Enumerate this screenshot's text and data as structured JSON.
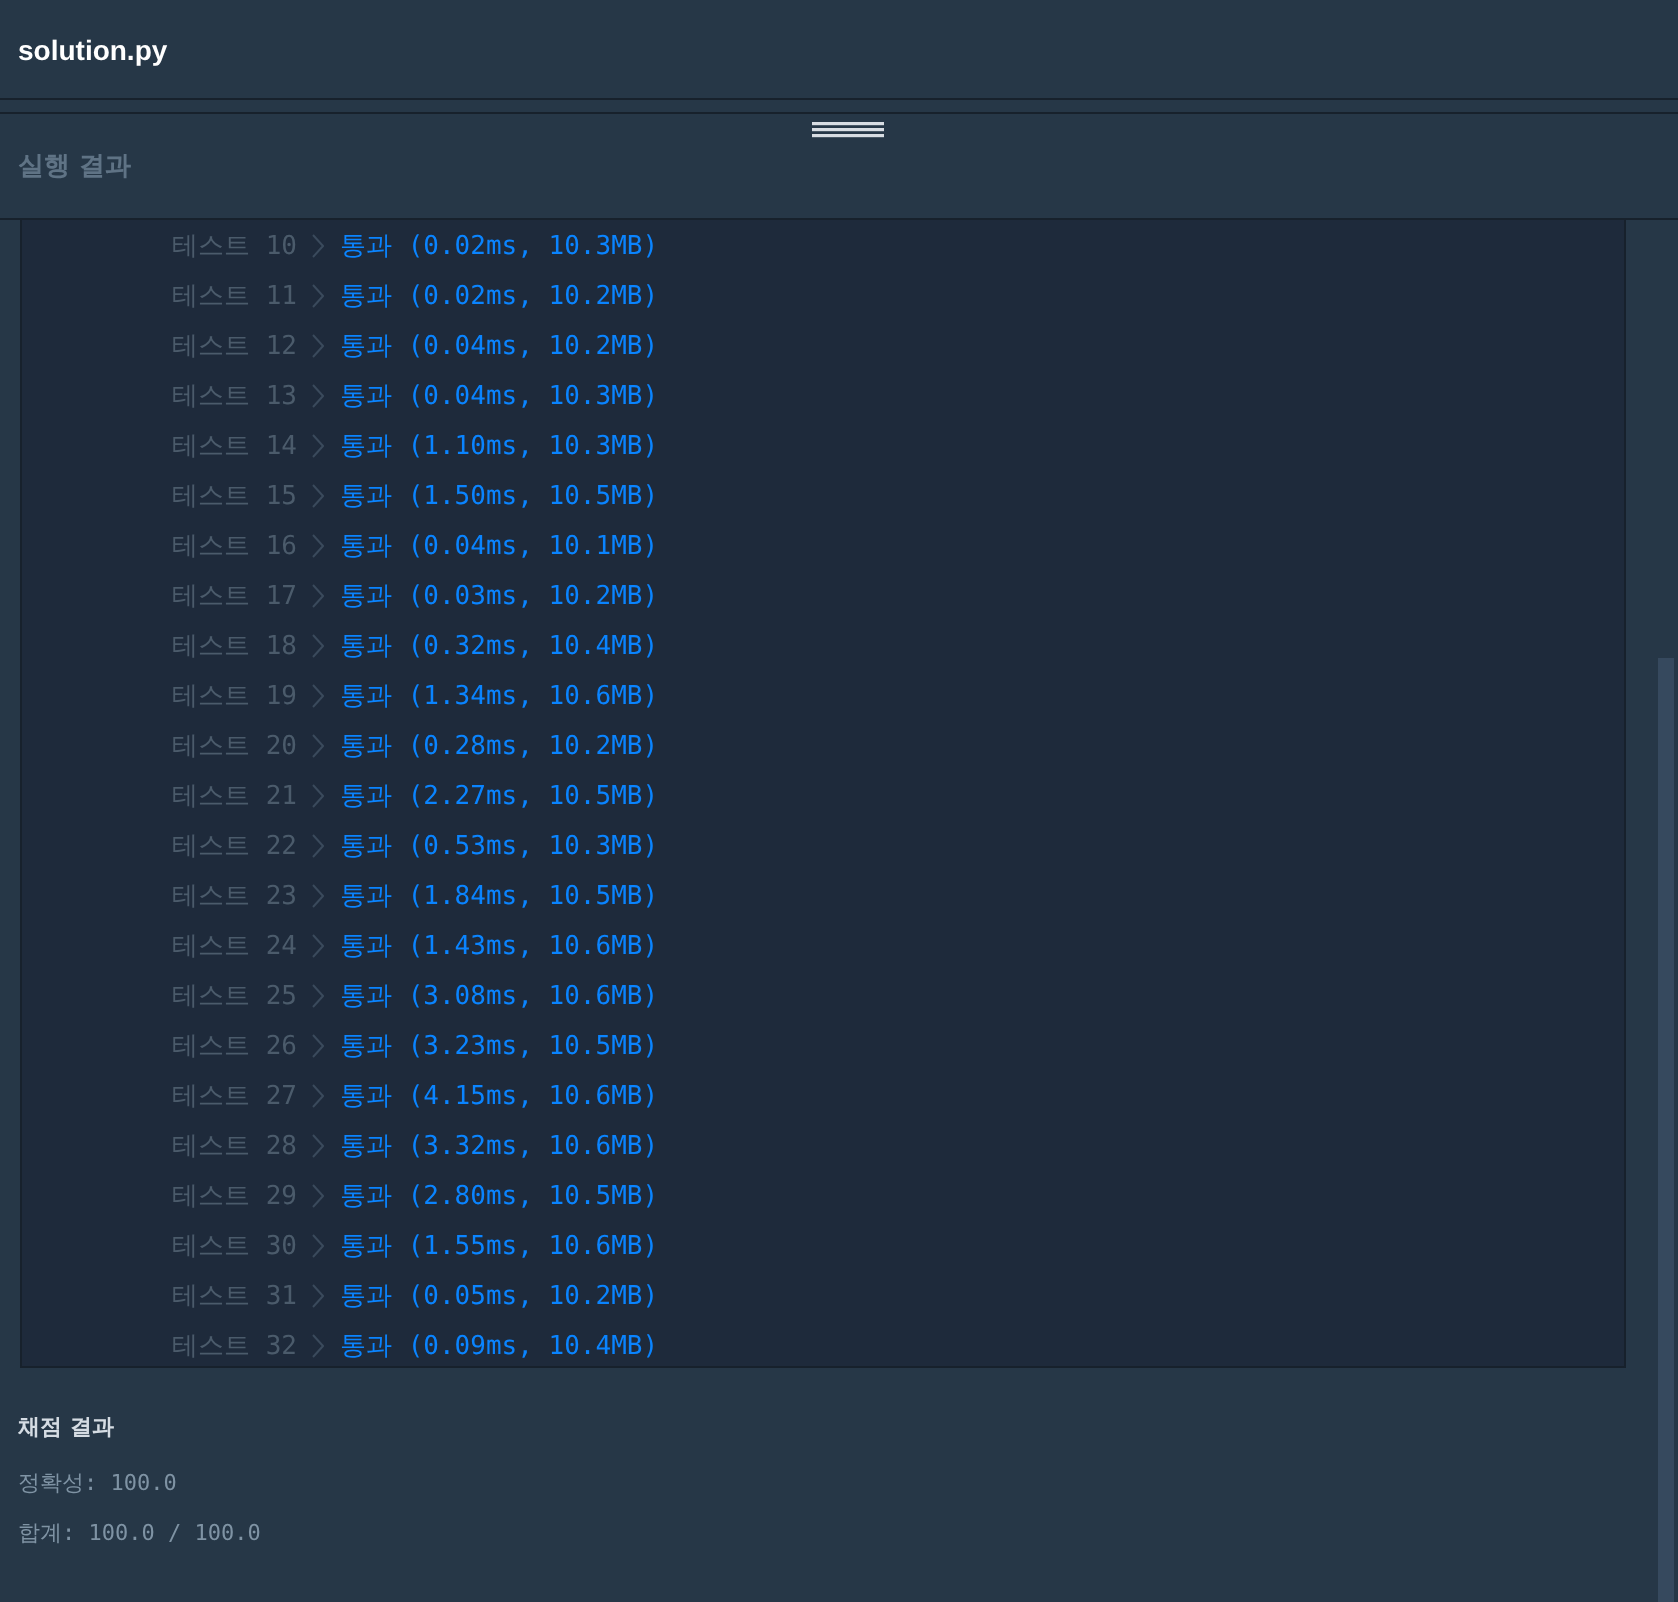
{
  "file_tab": {
    "title": "solution.py"
  },
  "output_panel": {
    "title": "실행 결과",
    "tests": [
      {
        "label": "테스트 10",
        "passed": true,
        "result": "통과 (0.02ms, 10.3MB)"
      },
      {
        "label": "테스트 11",
        "passed": true,
        "result": "통과 (0.02ms, 10.2MB)"
      },
      {
        "label": "테스트 12",
        "passed": true,
        "result": "통과 (0.04ms, 10.2MB)"
      },
      {
        "label": "테스트 13",
        "passed": true,
        "result": "통과 (0.04ms, 10.3MB)"
      },
      {
        "label": "테스트 14",
        "passed": true,
        "result": "통과 (1.10ms, 10.3MB)"
      },
      {
        "label": "테스트 15",
        "passed": true,
        "result": "통과 (1.50ms, 10.5MB)"
      },
      {
        "label": "테스트 16",
        "passed": true,
        "result": "통과 (0.04ms, 10.1MB)"
      },
      {
        "label": "테스트 17",
        "passed": true,
        "result": "통과 (0.03ms, 10.2MB)"
      },
      {
        "label": "테스트 18",
        "passed": true,
        "result": "통과 (0.32ms, 10.4MB)"
      },
      {
        "label": "테스트 19",
        "passed": true,
        "result": "통과 (1.34ms, 10.6MB)"
      },
      {
        "label": "테스트 20",
        "passed": true,
        "result": "통과 (0.28ms, 10.2MB)"
      },
      {
        "label": "테스트 21",
        "passed": true,
        "result": "통과 (2.27ms, 10.5MB)"
      },
      {
        "label": "테스트 22",
        "passed": true,
        "result": "통과 (0.53ms, 10.3MB)"
      },
      {
        "label": "테스트 23",
        "passed": true,
        "result": "통과 (1.84ms, 10.5MB)"
      },
      {
        "label": "테스트 24",
        "passed": true,
        "result": "통과 (1.43ms, 10.6MB)"
      },
      {
        "label": "테스트 25",
        "passed": true,
        "result": "통과 (3.08ms, 10.6MB)"
      },
      {
        "label": "테스트 26",
        "passed": true,
        "result": "통과 (3.23ms, 10.5MB)"
      },
      {
        "label": "테스트 27",
        "passed": true,
        "result": "통과 (4.15ms, 10.6MB)"
      },
      {
        "label": "테스트 28",
        "passed": true,
        "result": "통과 (3.32ms, 10.6MB)"
      },
      {
        "label": "테스트 29",
        "passed": true,
        "result": "통과 (2.80ms, 10.5MB)"
      },
      {
        "label": "테스트 30",
        "passed": true,
        "result": "통과 (1.55ms, 10.6MB)"
      },
      {
        "label": "테스트 31",
        "passed": true,
        "result": "통과 (0.05ms, 10.2MB)"
      },
      {
        "label": "테스트 32",
        "passed": true,
        "result": "통과 (0.09ms, 10.4MB)"
      }
    ]
  },
  "grading": {
    "title": "채점 결과",
    "accuracy": "정확성: 100.0",
    "total": "합계: 100.0 / 100.0"
  }
}
